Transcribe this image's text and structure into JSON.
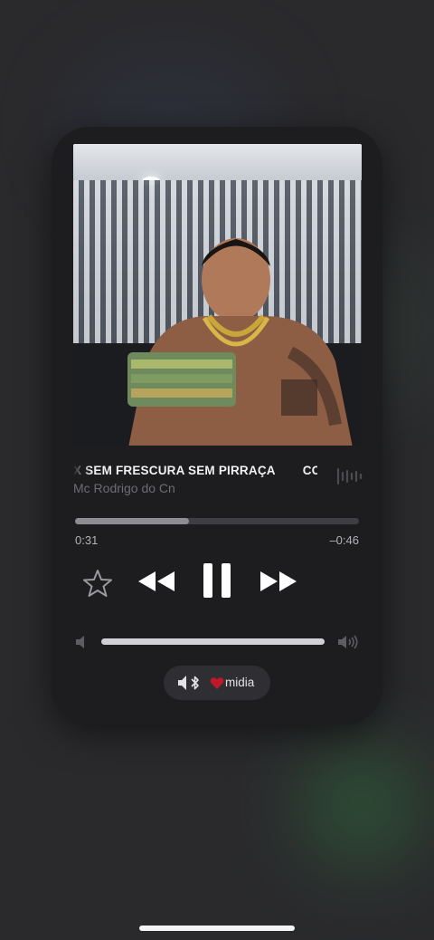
{
  "now_playing": {
    "title": "X SEM FRESCURA SEM PIRRAÇA",
    "title_next_fragment": "COI",
    "artist": "Mc Rodrigo do Cn",
    "artwork_description_icon": "album-artwork"
  },
  "playback": {
    "elapsed": "0:31",
    "remaining": "–0:46",
    "progress": 0.4,
    "state": "playing"
  },
  "volume": {
    "level": 1.0
  },
  "output_route": {
    "label": "midia",
    "icon": "speaker-bluetooth-icon"
  },
  "controls": {
    "favorite_icon": "star-icon",
    "rewind_icon": "rewind-icon",
    "pause_icon": "pause-icon",
    "forward_icon": "fast-forward-icon",
    "waveform_icon": "waveform-icon"
  },
  "colors": {
    "background": "#2a2a2d",
    "card": "#1d1c1e",
    "text_primary": "#f1f1f3",
    "text_secondary": "#6e6d72",
    "accent_heart": "#c0182b"
  }
}
